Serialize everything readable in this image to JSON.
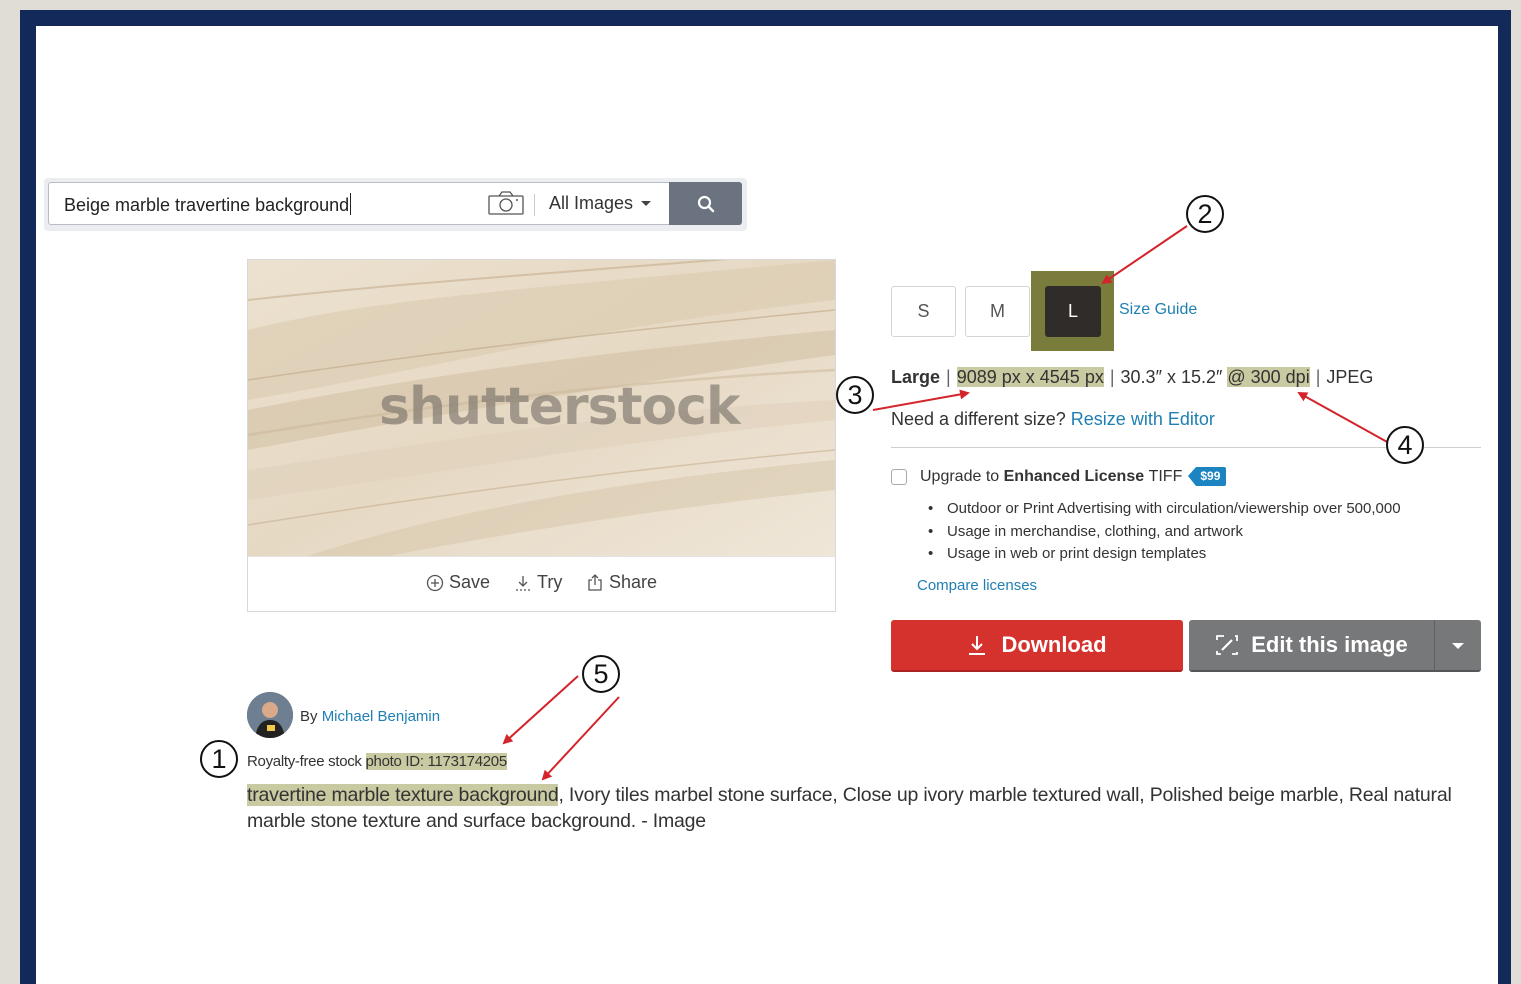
{
  "search": {
    "query": "Beige marble travertine background",
    "scope": "All Images",
    "camera_icon": "camera-icon",
    "search_icon": "search-icon"
  },
  "preview": {
    "watermark": "shutterstock",
    "actions": {
      "save": "Save",
      "try": "Try",
      "share": "Share"
    }
  },
  "sizes": {
    "options": [
      "S",
      "M",
      "L"
    ],
    "selected": "L",
    "guide": "Size Guide"
  },
  "spec": {
    "name": "Large",
    "pixels": "9089 px x 4545 px",
    "inches": "30.3″ x 15.2″",
    "dpi": "@ 300 dpi",
    "format": "JPEG"
  },
  "resize": {
    "prompt": "Need a different size?",
    "link": "Resize with Editor"
  },
  "license": {
    "prefix": "Upgrade to",
    "name": "Enhanced License",
    "suffix": "TIFF",
    "price": "$99",
    "bullets": [
      "Outdoor or Print Advertising with circulation/viewership over 500,000",
      "Usage in merchandise, clothing, and artwork",
      "Usage in web or print design templates"
    ],
    "compare": "Compare licenses"
  },
  "buttons": {
    "download": "Download",
    "edit": "Edit this image"
  },
  "contributor": {
    "by": "By",
    "name": "Michael Benjamin"
  },
  "photo": {
    "prefix": "Royalty-free stock",
    "id": "photo ID: 1173174205",
    "title_highlight": "travertine marble texture background",
    "description_rest": ", Ivory tiles marbel stone surface, Close up ivory marble textured wall, Polished beige marble, Real natural marble stone texture and surface background. - Image"
  },
  "annotations": [
    "1",
    "2",
    "3",
    "4",
    "5"
  ],
  "colors": {
    "highlight": "#c9caa1",
    "size_highlight": "#7a7c3c",
    "download": "#d5322e",
    "edit": "#77787a",
    "link": "#1f7fb3",
    "arrow": "#d4232a",
    "frame": "#13295a",
    "price_tag": "#1d84c2"
  }
}
